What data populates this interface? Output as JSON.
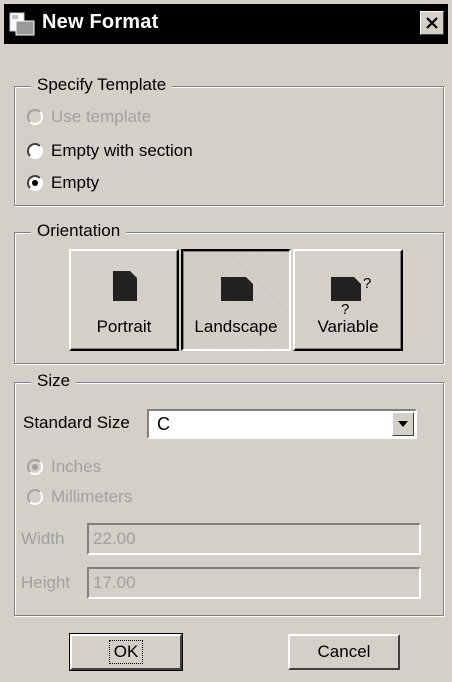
{
  "window": {
    "title": "New Format"
  },
  "template": {
    "legend": "Specify Template",
    "options": [
      {
        "label": "Use template",
        "selected": false,
        "enabled": false
      },
      {
        "label": "Empty with section",
        "selected": false,
        "enabled": true
      },
      {
        "label": "Empty",
        "selected": true,
        "enabled": true
      }
    ]
  },
  "orientation": {
    "legend": "Orientation",
    "buttons": [
      {
        "label": "Portrait",
        "icon": "portrait-page-icon",
        "pressed": false
      },
      {
        "label": "Landscape",
        "icon": "landscape-page-icon",
        "pressed": true
      },
      {
        "label": "Variable",
        "icon": "variable-page-icon",
        "pressed": false,
        "marks": [
          "?",
          "?"
        ]
      }
    ]
  },
  "size": {
    "legend": "Size",
    "standard_label": "Standard Size",
    "standard_value": "C",
    "units": [
      {
        "label": "Inches",
        "selected": true,
        "enabled": false
      },
      {
        "label": "Millimeters",
        "selected": false,
        "enabled": false
      }
    ],
    "width_label": "Width",
    "width_value": "22.00",
    "height_label": "Height",
    "height_value": "17.00"
  },
  "buttons": {
    "ok": "OK",
    "cancel": "Cancel"
  },
  "colors": {
    "titlebar": "#000000",
    "dialog": "#d4d0c8",
    "disabled_text": "#a0a0a0"
  }
}
